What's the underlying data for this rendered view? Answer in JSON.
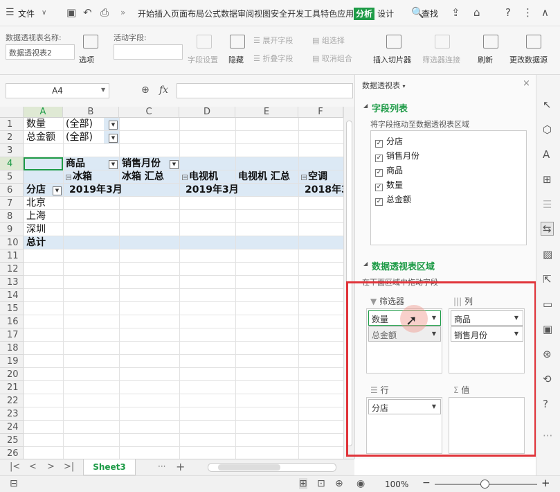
{
  "menubar": {
    "file_label": "文件",
    "tabs": [
      "开始",
      "插入",
      "页面布局",
      "公式",
      "数据",
      "审阅",
      "视图",
      "安全",
      "开发工具",
      "特色应用"
    ],
    "active_tab": "分析",
    "design_tab": "设计",
    "search_label": "查找"
  },
  "ribbon": {
    "pivot_name_label": "数据透视表名称:",
    "pivot_name_value": "数据透视表2",
    "options_label": "选项",
    "active_field_label": "活动字段:",
    "field_settings": "字段设置",
    "hide": "隐藏",
    "expand_field": "展开字段",
    "collapse_field": "折叠字段",
    "group_selection": "组选择",
    "ungroup": "取消组合",
    "insert_slicer": "插入切片器",
    "filter_connection": "筛选器连接",
    "refresh": "刷新",
    "change_source": "更改数据源"
  },
  "formula": {
    "cell_ref": "A4",
    "fx_label": "fx"
  },
  "sheet": {
    "columns": [
      "A",
      "B",
      "C",
      "D",
      "E",
      "F"
    ],
    "rows": [
      "1",
      "2",
      "3",
      "4",
      "5",
      "6",
      "7",
      "8",
      "9",
      "10",
      "11",
      "12",
      "13",
      "14",
      "15",
      "16",
      "17",
      "18",
      "19",
      "20",
      "21",
      "22",
      "23",
      "24",
      "25",
      "26"
    ],
    "r1a": "数量",
    "r1b": "(全部)",
    "r2a": "总金额",
    "r2b": "(全部)",
    "r4b": "商品",
    "r4c": "销售月份",
    "r5b": "冰箱",
    "r5c": "冰箱 汇总",
    "r5d": "电视机",
    "r5e": "电视机 汇总",
    "r5f": "空调",
    "r6a": "分店",
    "r6b": "2019年3月",
    "r6d": "2019年3月",
    "r6f": "2018年3",
    "r7a": "北京",
    "r8a": "上海",
    "r9a": "深圳",
    "r10a": "总计"
  },
  "tabbar": {
    "sheet_tab": "Sheet3"
  },
  "status": {
    "zoom": "100%"
  },
  "pane": {
    "title": "数据透视表",
    "field_list_title": "字段列表",
    "field_list_hint": "将字段拖动至数据透视表区域",
    "fields": [
      "分店",
      "销售月份",
      "商品",
      "数量",
      "总金额"
    ],
    "area_title": "数据透视表区域",
    "area_hint": "在下面区域中拖动字段",
    "filter_label": "筛选器",
    "column_label": "列",
    "row_label": "行",
    "value_label": "值",
    "filter_items": [
      "数量",
      "总金额"
    ],
    "column_items": [
      "商品",
      "销售月份"
    ],
    "row_items": [
      "分店"
    ]
  },
  "colors": {
    "accent": "#1e9b47",
    "highlight_box": "#e0343a",
    "pivot_fill": "#dce9f5"
  }
}
